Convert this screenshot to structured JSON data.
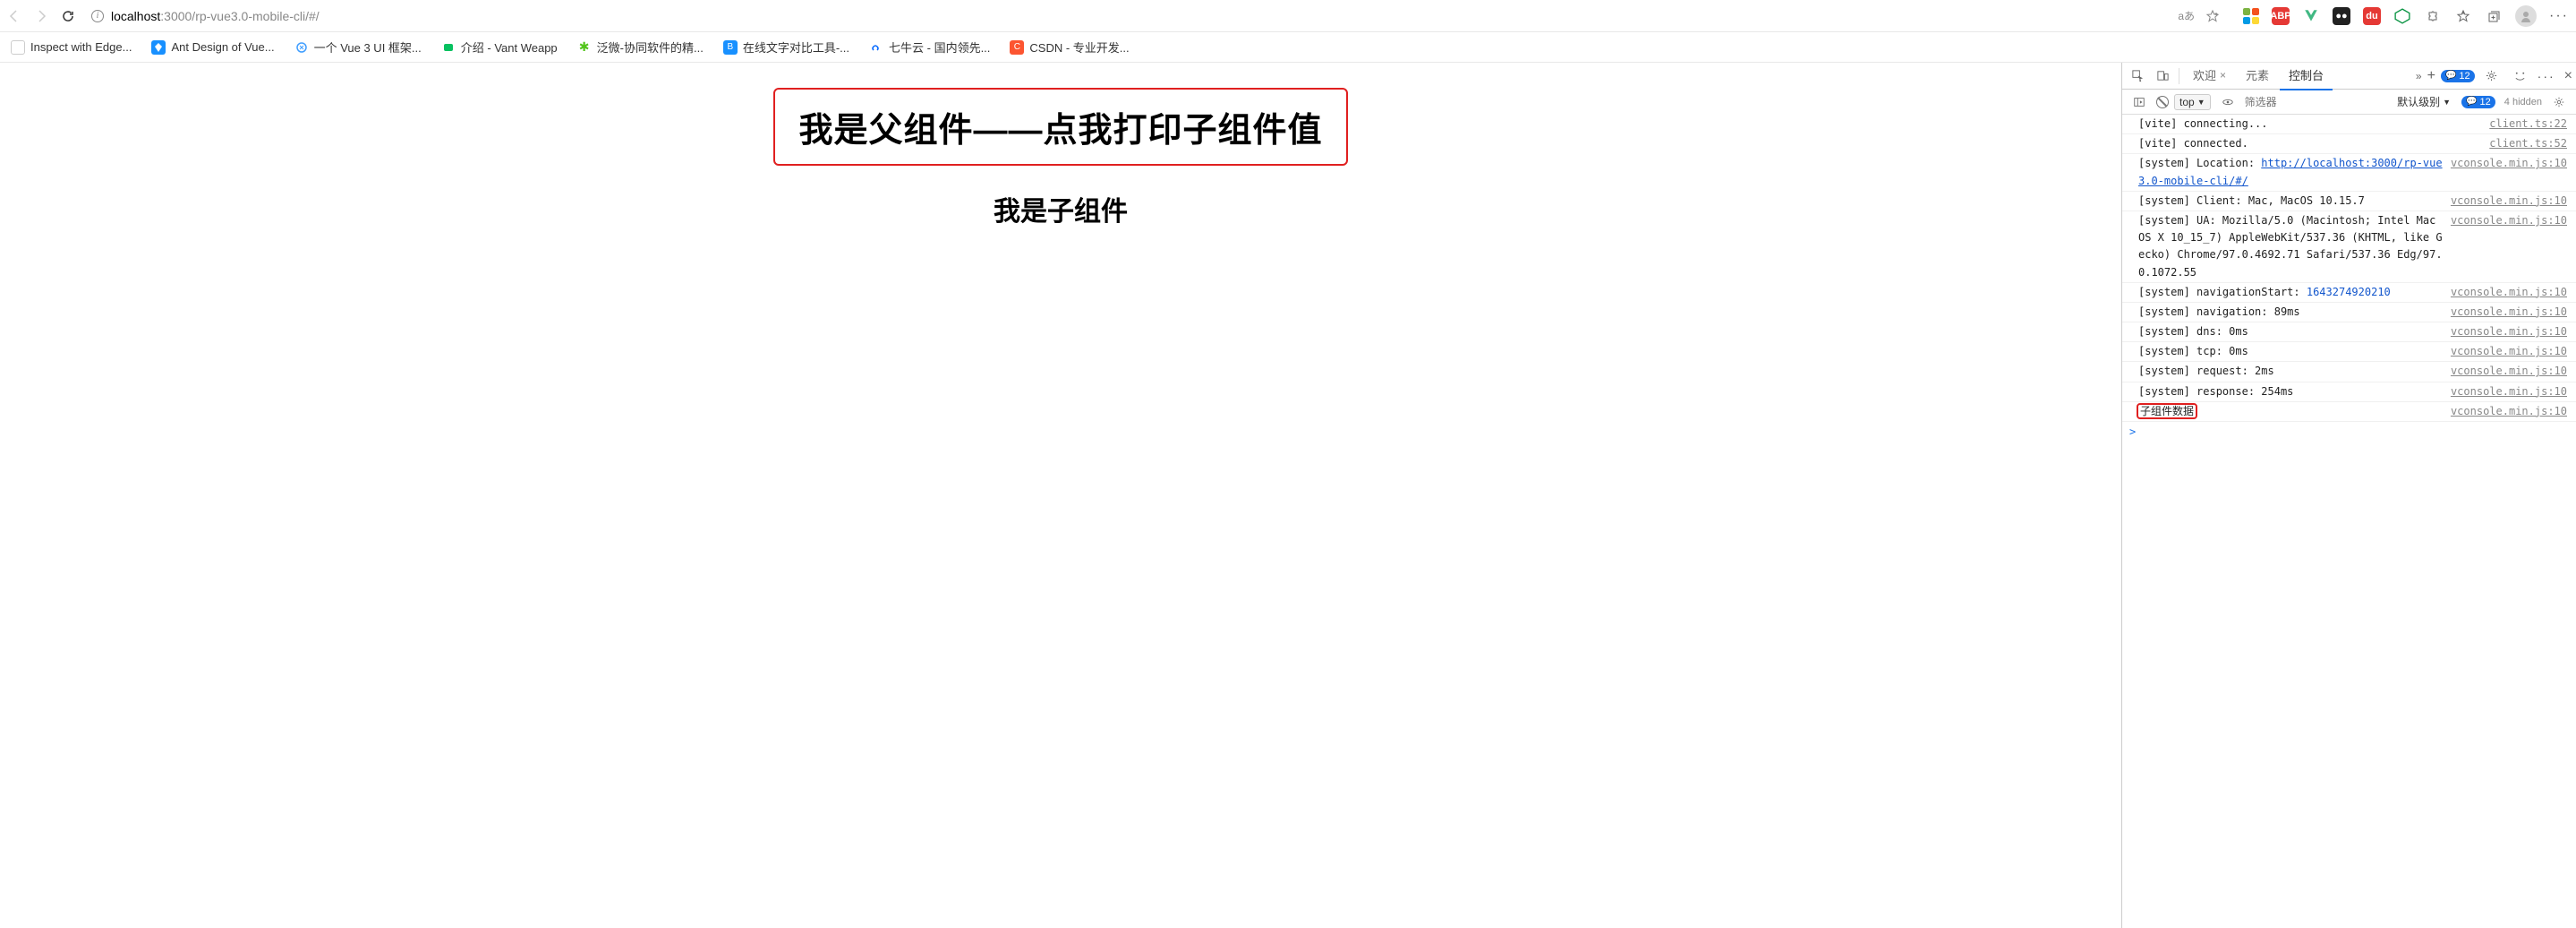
{
  "browser": {
    "url_host": "localhost",
    "url_path": ":3000/rp-vue3.0-mobile-cli/#/",
    "reader_label": "aあ"
  },
  "bookmarks": [
    {
      "label": "Inspect with Edge...",
      "icon_bg": "#fff",
      "icon_border": "1px solid #ccc",
      "text": ""
    },
    {
      "label": "Ant Design of Vue...",
      "icon_bg": "#1890ff",
      "text": ""
    },
    {
      "label": "一个 Vue 3 UI 框架...",
      "icon_bg": "#409eff",
      "text": ""
    },
    {
      "label": "介绍 - Vant Weapp",
      "icon_bg": "#07c160",
      "text": ""
    },
    {
      "label": "泛微-协同软件的精...",
      "icon_bg": "#52c41a",
      "text": "✱"
    },
    {
      "label": "在线文字对比工具-...",
      "icon_bg": "#1890ff",
      "text": "B"
    },
    {
      "label": "七牛云 - 国内领先...",
      "icon_bg": "#fff",
      "icon_border": "1px solid #ccc",
      "text": ""
    },
    {
      "label": "CSDN - 专业开发...",
      "icon_bg": "#fc5531",
      "text": "C"
    }
  ],
  "page": {
    "parent_text": "我是父组件——点我打印子组件值",
    "child_text": "我是子组件"
  },
  "devtools": {
    "tabs": {
      "welcome": "欢迎",
      "elements": "元素",
      "console": "控制台"
    },
    "issue_count": "12",
    "sub": {
      "context": "top",
      "filter_placeholder": "筛选器",
      "level": "默认级别",
      "badge_count": "12",
      "hidden": "4 hidden"
    },
    "logs": [
      {
        "msg_pre": "[vite] connecting...",
        "src": "client.ts:22"
      },
      {
        "msg_pre": "[vite] connected.",
        "src": "client.ts:52"
      },
      {
        "msg_pre": "[system] Location: ",
        "link": "http://localhost:3000/rp-vue3.0-mobile-cli/#/",
        "src": "vconsole.min.js:10"
      },
      {
        "msg_pre": "[system] Client: Mac, MacOS 10.15.7",
        "src": "vconsole.min.js:10"
      },
      {
        "msg_pre": "[system] UA: Mozilla/5.0 (Macintosh; Intel Mac OS X 10_15_7) AppleWebKit/537.36 (KHTML, like Gecko) Chrome/97.0.4692.71 Safari/537.36 Edg/97.0.1072.55",
        "src": "vconsole.min.js:10"
      },
      {
        "msg_pre": "[system] navigationStart: ",
        "num": "1643274920210",
        "src": "vconsole.min.js:10"
      },
      {
        "msg_pre": "[system] navigation: 89ms",
        "src": "vconsole.min.js:10"
      },
      {
        "msg_pre": "[system] dns: 0ms",
        "src": "vconsole.min.js:10"
      },
      {
        "msg_pre": "[system] tcp: 0ms",
        "src": "vconsole.min.js:10"
      },
      {
        "msg_pre": "[system] request: 2ms",
        "src": "vconsole.min.js:10"
      },
      {
        "msg_pre": "[system] response: 254ms",
        "src": "vconsole.min.js:10",
        "hl_overlap": true
      },
      {
        "msg_pre": "子组件数据",
        "src": "vconsole.min.js:10",
        "hl": true
      }
    ],
    "prompt": ">"
  }
}
